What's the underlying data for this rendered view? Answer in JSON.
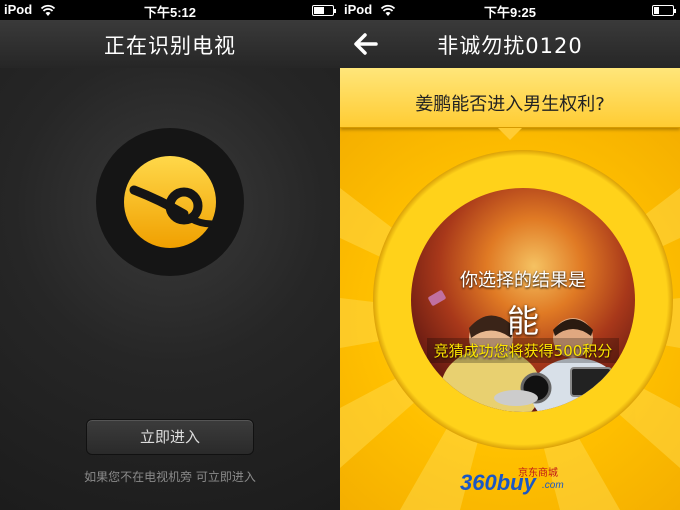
{
  "left": {
    "status": {
      "carrier": "iPod",
      "time": "下午5:12"
    },
    "nav": {
      "title": "正在识别电视"
    },
    "enter_button": "立即进入",
    "hint": "如果您不在电视机旁  可立即进入",
    "brand_color": "#f5b800"
  },
  "right": {
    "status": {
      "carrier": "iPod",
      "time": "下午9:25"
    },
    "nav": {
      "title": "非诚勿扰0120",
      "back_icon": "back-arrow-icon"
    },
    "question": "姜鹏能否进入男生权利?",
    "result_label": "你选择的结果是",
    "result_value": "能",
    "reward": "竞猜成功您将获得500积分",
    "sponsor": {
      "main": "360",
      "buy": "buy",
      "cn": "京东商城",
      "com": ".com"
    },
    "accent_color": "#ffc000"
  }
}
